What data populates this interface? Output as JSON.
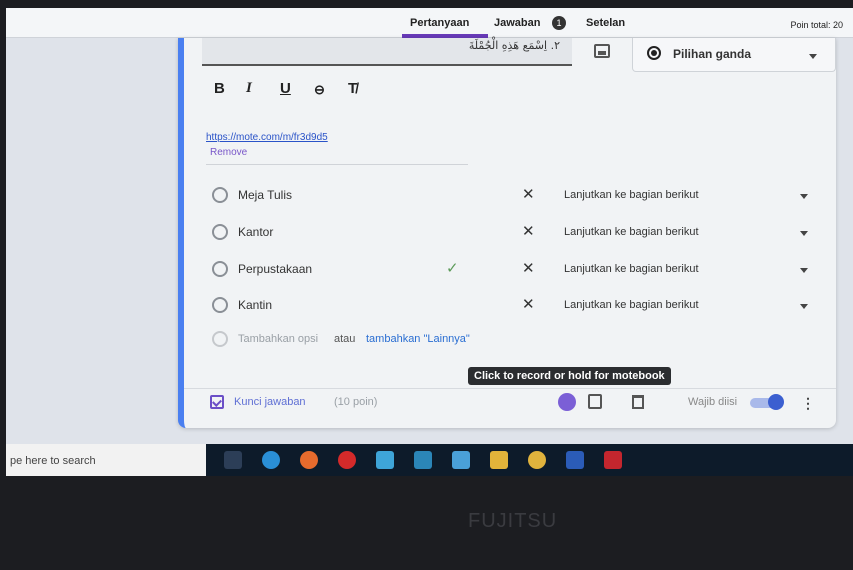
{
  "tabs": {
    "questions": "Pertanyaan",
    "answers": "Jawaban",
    "answers_badge": "1",
    "settings": "Setelan"
  },
  "points_total": "Poin total: 20",
  "question": {
    "text": "٢. اِسْمَع هَذِهِ الْجُمْلَةَ",
    "type": "Pilihan ganda"
  },
  "formatting": {
    "bold": "B",
    "italic": "I",
    "underline": "U",
    "link": "⊖",
    "clear": "T̸"
  },
  "attachment": {
    "link": "https://mote.com/m/fr3d9d5",
    "remove": "Remove"
  },
  "options": [
    {
      "label": "Meja Tulis",
      "goto": "Lanjutkan ke bagian berikut",
      "correct": false
    },
    {
      "label": "Kantor",
      "goto": "Lanjutkan ke bagian berikut",
      "correct": false
    },
    {
      "label": "Perpustakaan",
      "goto": "Lanjutkan ke bagian berikut",
      "correct": true
    },
    {
      "label": "Kantin",
      "goto": "Lanjutkan ke bagian berikut",
      "correct": false
    }
  ],
  "add_option": {
    "label": "Tambahkan opsi",
    "or": "atau",
    "add_other": "tambahkan \"Lainnya\""
  },
  "tooltip": "Click to record or hold for motebook",
  "footer": {
    "answer_key": "Kunci jawaban",
    "points": "(10 poin)",
    "required": "Wajib diisi",
    "required_on": true
  },
  "taskbar": {
    "search": "pe here to search"
  },
  "bezel": {
    "brand": "FUJITSU"
  },
  "icons": {
    "taskbar": [
      "task-view-icon",
      "edge-icon",
      "firefox-icon",
      "opera-icon",
      "app-icon",
      "store-icon",
      "calculator-icon",
      "file-explorer-icon",
      "chrome-icon",
      "word-icon",
      "mendeley-icon"
    ]
  },
  "colors": {
    "accent": "#673ab7",
    "card_border": "#4a7ff0",
    "link": "#2a53c8",
    "toggle": "#3b5fd0"
  }
}
